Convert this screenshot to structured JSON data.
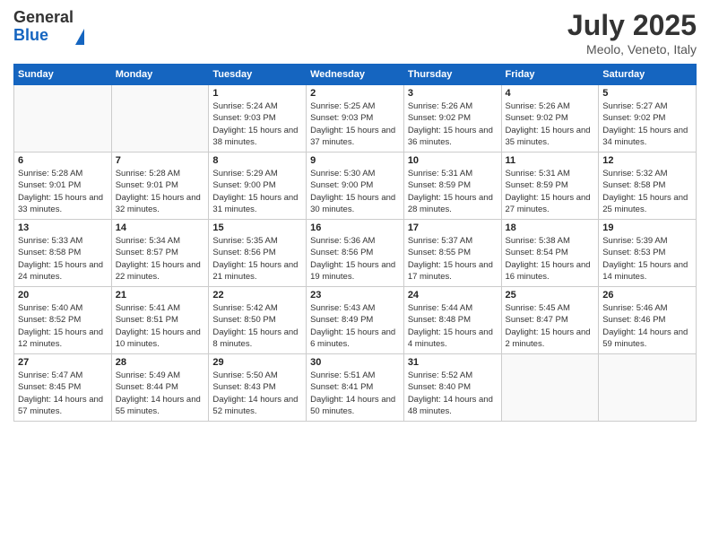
{
  "logo": {
    "general": "General",
    "blue": "Blue"
  },
  "title": "July 2025",
  "location": "Meolo, Veneto, Italy",
  "days_header": [
    "Sunday",
    "Monday",
    "Tuesday",
    "Wednesday",
    "Thursday",
    "Friday",
    "Saturday"
  ],
  "weeks": [
    [
      {
        "day": "",
        "sunrise": "",
        "sunset": "",
        "daylight": ""
      },
      {
        "day": "",
        "sunrise": "",
        "sunset": "",
        "daylight": ""
      },
      {
        "day": "1",
        "sunrise": "Sunrise: 5:24 AM",
        "sunset": "Sunset: 9:03 PM",
        "daylight": "Daylight: 15 hours and 38 minutes."
      },
      {
        "day": "2",
        "sunrise": "Sunrise: 5:25 AM",
        "sunset": "Sunset: 9:03 PM",
        "daylight": "Daylight: 15 hours and 37 minutes."
      },
      {
        "day": "3",
        "sunrise": "Sunrise: 5:26 AM",
        "sunset": "Sunset: 9:02 PM",
        "daylight": "Daylight: 15 hours and 36 minutes."
      },
      {
        "day": "4",
        "sunrise": "Sunrise: 5:26 AM",
        "sunset": "Sunset: 9:02 PM",
        "daylight": "Daylight: 15 hours and 35 minutes."
      },
      {
        "day": "5",
        "sunrise": "Sunrise: 5:27 AM",
        "sunset": "Sunset: 9:02 PM",
        "daylight": "Daylight: 15 hours and 34 minutes."
      }
    ],
    [
      {
        "day": "6",
        "sunrise": "Sunrise: 5:28 AM",
        "sunset": "Sunset: 9:01 PM",
        "daylight": "Daylight: 15 hours and 33 minutes."
      },
      {
        "day": "7",
        "sunrise": "Sunrise: 5:28 AM",
        "sunset": "Sunset: 9:01 PM",
        "daylight": "Daylight: 15 hours and 32 minutes."
      },
      {
        "day": "8",
        "sunrise": "Sunrise: 5:29 AM",
        "sunset": "Sunset: 9:00 PM",
        "daylight": "Daylight: 15 hours and 31 minutes."
      },
      {
        "day": "9",
        "sunrise": "Sunrise: 5:30 AM",
        "sunset": "Sunset: 9:00 PM",
        "daylight": "Daylight: 15 hours and 30 minutes."
      },
      {
        "day": "10",
        "sunrise": "Sunrise: 5:31 AM",
        "sunset": "Sunset: 8:59 PM",
        "daylight": "Daylight: 15 hours and 28 minutes."
      },
      {
        "day": "11",
        "sunrise": "Sunrise: 5:31 AM",
        "sunset": "Sunset: 8:59 PM",
        "daylight": "Daylight: 15 hours and 27 minutes."
      },
      {
        "day": "12",
        "sunrise": "Sunrise: 5:32 AM",
        "sunset": "Sunset: 8:58 PM",
        "daylight": "Daylight: 15 hours and 25 minutes."
      }
    ],
    [
      {
        "day": "13",
        "sunrise": "Sunrise: 5:33 AM",
        "sunset": "Sunset: 8:58 PM",
        "daylight": "Daylight: 15 hours and 24 minutes."
      },
      {
        "day": "14",
        "sunrise": "Sunrise: 5:34 AM",
        "sunset": "Sunset: 8:57 PM",
        "daylight": "Daylight: 15 hours and 22 minutes."
      },
      {
        "day": "15",
        "sunrise": "Sunrise: 5:35 AM",
        "sunset": "Sunset: 8:56 PM",
        "daylight": "Daylight: 15 hours and 21 minutes."
      },
      {
        "day": "16",
        "sunrise": "Sunrise: 5:36 AM",
        "sunset": "Sunset: 8:56 PM",
        "daylight": "Daylight: 15 hours and 19 minutes."
      },
      {
        "day": "17",
        "sunrise": "Sunrise: 5:37 AM",
        "sunset": "Sunset: 8:55 PM",
        "daylight": "Daylight: 15 hours and 17 minutes."
      },
      {
        "day": "18",
        "sunrise": "Sunrise: 5:38 AM",
        "sunset": "Sunset: 8:54 PM",
        "daylight": "Daylight: 15 hours and 16 minutes."
      },
      {
        "day": "19",
        "sunrise": "Sunrise: 5:39 AM",
        "sunset": "Sunset: 8:53 PM",
        "daylight": "Daylight: 15 hours and 14 minutes."
      }
    ],
    [
      {
        "day": "20",
        "sunrise": "Sunrise: 5:40 AM",
        "sunset": "Sunset: 8:52 PM",
        "daylight": "Daylight: 15 hours and 12 minutes."
      },
      {
        "day": "21",
        "sunrise": "Sunrise: 5:41 AM",
        "sunset": "Sunset: 8:51 PM",
        "daylight": "Daylight: 15 hours and 10 minutes."
      },
      {
        "day": "22",
        "sunrise": "Sunrise: 5:42 AM",
        "sunset": "Sunset: 8:50 PM",
        "daylight": "Daylight: 15 hours and 8 minutes."
      },
      {
        "day": "23",
        "sunrise": "Sunrise: 5:43 AM",
        "sunset": "Sunset: 8:49 PM",
        "daylight": "Daylight: 15 hours and 6 minutes."
      },
      {
        "day": "24",
        "sunrise": "Sunrise: 5:44 AM",
        "sunset": "Sunset: 8:48 PM",
        "daylight": "Daylight: 15 hours and 4 minutes."
      },
      {
        "day": "25",
        "sunrise": "Sunrise: 5:45 AM",
        "sunset": "Sunset: 8:47 PM",
        "daylight": "Daylight: 15 hours and 2 minutes."
      },
      {
        "day": "26",
        "sunrise": "Sunrise: 5:46 AM",
        "sunset": "Sunset: 8:46 PM",
        "daylight": "Daylight: 14 hours and 59 minutes."
      }
    ],
    [
      {
        "day": "27",
        "sunrise": "Sunrise: 5:47 AM",
        "sunset": "Sunset: 8:45 PM",
        "daylight": "Daylight: 14 hours and 57 minutes."
      },
      {
        "day": "28",
        "sunrise": "Sunrise: 5:49 AM",
        "sunset": "Sunset: 8:44 PM",
        "daylight": "Daylight: 14 hours and 55 minutes."
      },
      {
        "day": "29",
        "sunrise": "Sunrise: 5:50 AM",
        "sunset": "Sunset: 8:43 PM",
        "daylight": "Daylight: 14 hours and 52 minutes."
      },
      {
        "day": "30",
        "sunrise": "Sunrise: 5:51 AM",
        "sunset": "Sunset: 8:41 PM",
        "daylight": "Daylight: 14 hours and 50 minutes."
      },
      {
        "day": "31",
        "sunrise": "Sunrise: 5:52 AM",
        "sunset": "Sunset: 8:40 PM",
        "daylight": "Daylight: 14 hours and 48 minutes."
      },
      {
        "day": "",
        "sunrise": "",
        "sunset": "",
        "daylight": ""
      },
      {
        "day": "",
        "sunrise": "",
        "sunset": "",
        "daylight": ""
      }
    ]
  ]
}
